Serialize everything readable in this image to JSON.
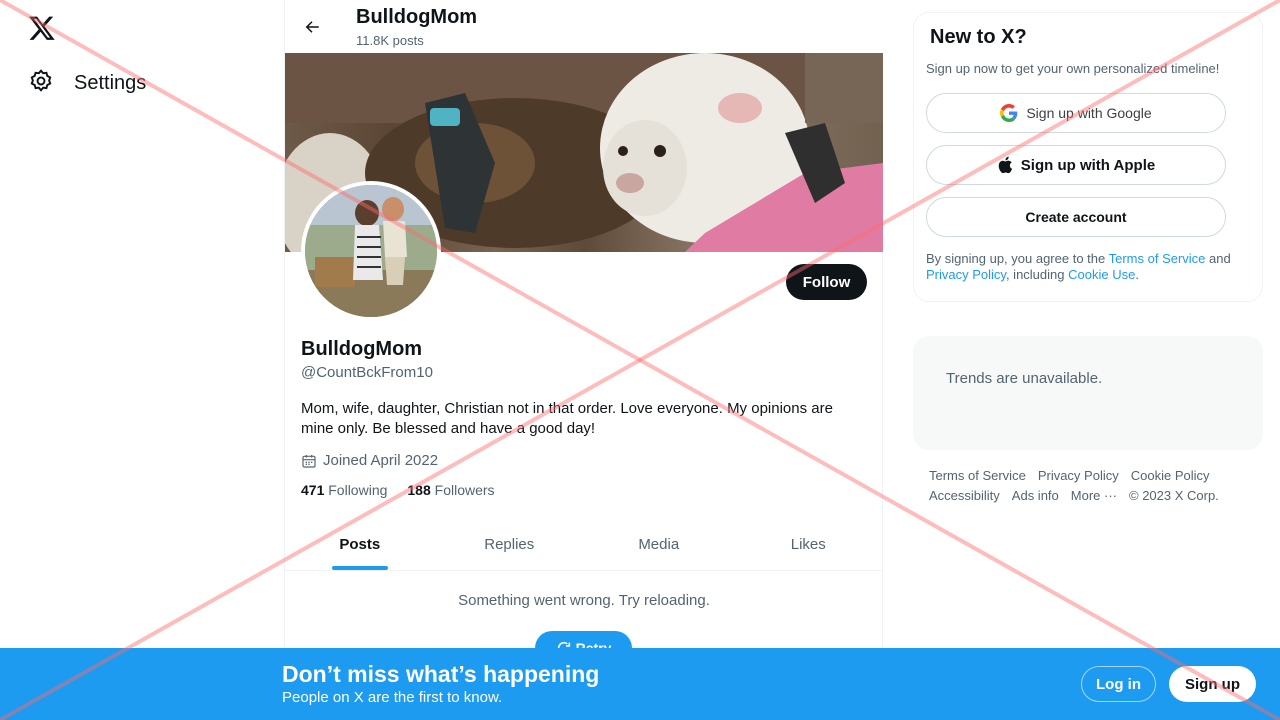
{
  "leftnav": {
    "logo_icon": "x-logo-icon",
    "settings_label": "Settings",
    "settings_icon": "gear-icon"
  },
  "header": {
    "name": "BulldogMom",
    "posts": "11.8K posts"
  },
  "profile": {
    "name": "BulldogMom",
    "handle": "@CountBckFrom10",
    "bio": "Mom, wife, daughter, Christian not in that order. Love everyone. My opinions are mine only. Be blessed and have a good day!",
    "joined": "Joined April 2022",
    "following_count": "471",
    "following_label": "Following",
    "followers_count": "188",
    "followers_label": "Followers",
    "follow_label": "Follow"
  },
  "tabs": [
    {
      "label": "Posts",
      "active": true
    },
    {
      "label": "Replies"
    },
    {
      "label": "Media"
    },
    {
      "label": "Likes"
    }
  ],
  "feed": {
    "error": "Something went wrong. Try reloading.",
    "retry_label": "Retry"
  },
  "signup_card": {
    "title": "New to X?",
    "subtitle": "Sign up now to get your own personalized timeline!",
    "google_label": "Sign up with Google",
    "apple_label": "Sign up with Apple",
    "create_label": "Create account",
    "terms_prefix": "By signing up, you agree to the ",
    "terms_link": "Terms of Service",
    "terms_and": " and ",
    "privacy_link": "Privacy Policy",
    "terms_including": ", including ",
    "cookie_link": "Cookie Use",
    "terms_end": "."
  },
  "trends": {
    "message": "Trends are unavailable."
  },
  "footer": {
    "links": [
      "Terms of Service",
      "Privacy Policy",
      "Cookie Policy",
      "Accessibility",
      "Ads info",
      "More ···"
    ],
    "copyright": "© 2023 X Corp."
  },
  "bottom_bar": {
    "title": "Don’t miss what’s happening",
    "subtitle": "People on X are the first to know.",
    "login_label": "Log in",
    "signup_label": "Sign up"
  },
  "colors": {
    "accent": "#1d9bf0",
    "text": "#0f1419",
    "muted": "#536471",
    "overlay_x": "#ff6b6b"
  }
}
